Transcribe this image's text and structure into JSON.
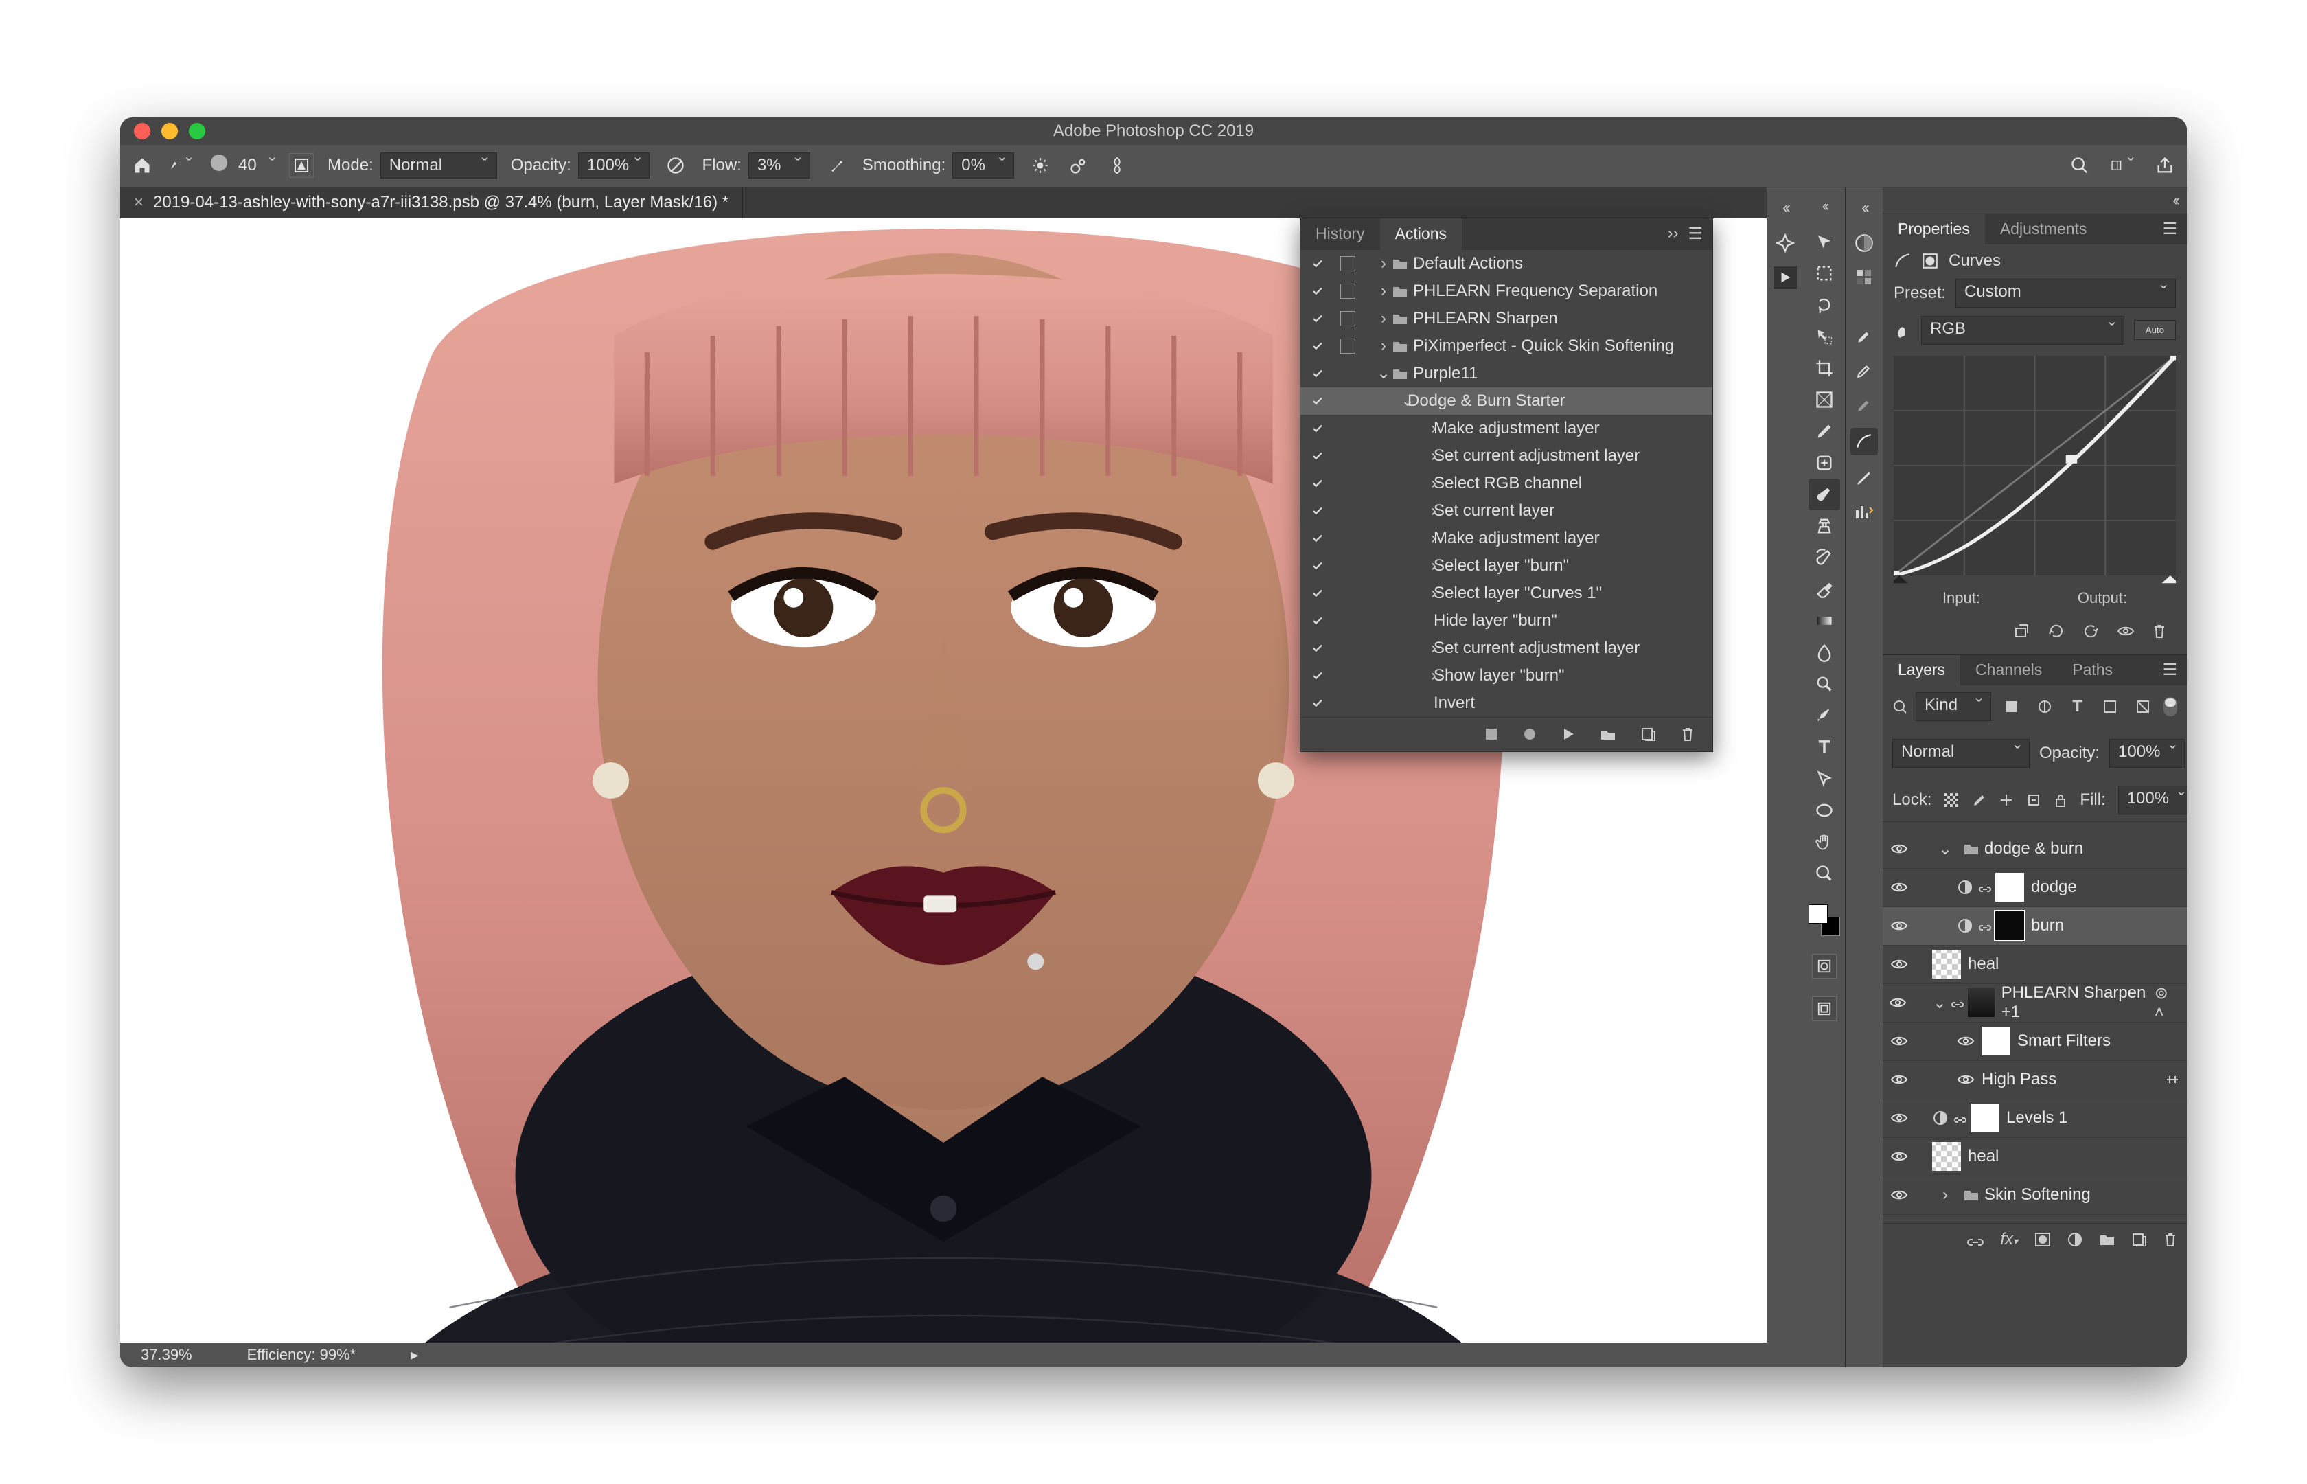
{
  "app": {
    "title": "Adobe Photoshop CC 2019"
  },
  "options": {
    "brush_size": "40",
    "mode_label": "Mode:",
    "mode_value": "Normal",
    "opacity_label": "Opacity:",
    "opacity_value": "100%",
    "flow_label": "Flow:",
    "flow_value": "3%",
    "smoothing_label": "Smoothing:",
    "smoothing_value": "0%"
  },
  "document": {
    "tab_title": "2019-04-13-ashley-with-sony-a7r-iii3138.psb @ 37.4% (burn, Layer Mask/16) *",
    "zoom": "37.39%",
    "efficiency": "Efficiency: 99%*"
  },
  "actions_panel": {
    "tabs": [
      "History",
      "Actions"
    ],
    "active_tab": "Actions",
    "sets": [
      {
        "label": "Default Actions",
        "check": true,
        "mode": true,
        "exp": ">",
        "kind": "folder",
        "depth": 1
      },
      {
        "label": "PHLEARN Frequency Separation",
        "check": true,
        "mode": true,
        "exp": ">",
        "kind": "folder",
        "depth": 1
      },
      {
        "label": "PHLEARN Sharpen",
        "check": true,
        "mode": true,
        "exp": ">",
        "kind": "folder",
        "depth": 1
      },
      {
        "label": "PiXimperfect - Quick Skin Softening",
        "check": true,
        "mode": true,
        "exp": ">",
        "kind": "folder",
        "depth": 1
      },
      {
        "label": "Purple11",
        "check": true,
        "mode": false,
        "exp": "v",
        "kind": "folder",
        "depth": 1
      },
      {
        "label": "Dodge & Burn Starter",
        "check": true,
        "mode": false,
        "exp": "v",
        "kind": "action",
        "depth": 2,
        "selected": true
      },
      {
        "label": "Make adjustment layer",
        "check": true,
        "mode": false,
        "exp": ">",
        "kind": "step",
        "depth": 3
      },
      {
        "label": "Set current adjustment layer",
        "check": true,
        "mode": false,
        "exp": ">",
        "kind": "step",
        "depth": 3
      },
      {
        "label": "Select RGB channel",
        "check": true,
        "mode": false,
        "exp": ">",
        "kind": "step",
        "depth": 3
      },
      {
        "label": "Set current layer",
        "check": true,
        "mode": false,
        "exp": ">",
        "kind": "step",
        "depth": 3
      },
      {
        "label": "Make adjustment layer",
        "check": true,
        "mode": false,
        "exp": ">",
        "kind": "step",
        "depth": 3
      },
      {
        "label": "Select layer \"burn\"",
        "check": true,
        "mode": false,
        "exp": ">",
        "kind": "step",
        "depth": 3
      },
      {
        "label": "Select layer \"Curves 1\"",
        "check": true,
        "mode": false,
        "exp": ">",
        "kind": "step",
        "depth": 3
      },
      {
        "label": "Hide layer \"burn\"",
        "check": true,
        "mode": false,
        "exp": "",
        "kind": "step",
        "depth": 3
      },
      {
        "label": "Set current adjustment layer",
        "check": true,
        "mode": false,
        "exp": ">",
        "kind": "step",
        "depth": 3
      },
      {
        "label": "Show layer \"burn\"",
        "check": true,
        "mode": false,
        "exp": ">",
        "kind": "step",
        "depth": 3
      },
      {
        "label": "Invert",
        "check": true,
        "mode": false,
        "exp": "",
        "kind": "step",
        "depth": 3
      }
    ]
  },
  "properties": {
    "tabs": [
      "Properties",
      "Adjustments"
    ],
    "active_tab": "Properties",
    "type_label": "Curves",
    "preset_label": "Preset:",
    "preset_value": "Custom",
    "channel_value": "RGB",
    "auto_label": "Auto",
    "input_label": "Input:",
    "output_label": "Output:"
  },
  "layers": {
    "tabs": [
      "Layers",
      "Channels",
      "Paths"
    ],
    "active_tab": "Layers",
    "filter_label": "Kind",
    "blend_mode": "Normal",
    "opacity_label": "Opacity:",
    "opacity_value": "100%",
    "lock_label": "Lock:",
    "fill_label": "Fill:",
    "fill_value": "100%",
    "items": [
      {
        "kind": "group",
        "label": "dodge & burn",
        "expanded": true,
        "indent": 0
      },
      {
        "kind": "adj",
        "label": "dodge",
        "indent": 1
      },
      {
        "kind": "adj",
        "label": "burn",
        "indent": 1,
        "selected": true
      },
      {
        "kind": "layer",
        "label": "heal",
        "indent": 0,
        "thumb": "hatch"
      },
      {
        "kind": "smart",
        "label": "PHLEARN Sharpen +1",
        "indent": 0,
        "expanded": true
      },
      {
        "kind": "sflabel",
        "label": "Smart Filters",
        "indent": 1
      },
      {
        "kind": "sf",
        "label": "High Pass",
        "indent": 1
      },
      {
        "kind": "adj",
        "label": "Levels 1",
        "indent": 0
      },
      {
        "kind": "layer",
        "label": "heal",
        "indent": 0,
        "thumb": "hatch"
      },
      {
        "kind": "group",
        "label": "Skin Softening",
        "indent": 0,
        "expanded": false
      }
    ]
  },
  "tools": [
    "move",
    "marquee",
    "lasso",
    "quick-select",
    "crop",
    "frame",
    "eyedropper",
    "heal",
    "brush",
    "clone",
    "history-brush",
    "eraser",
    "gradient",
    "blur",
    "dodge",
    "pen",
    "type",
    "path-select",
    "ellipse",
    "hand",
    "zoom"
  ]
}
